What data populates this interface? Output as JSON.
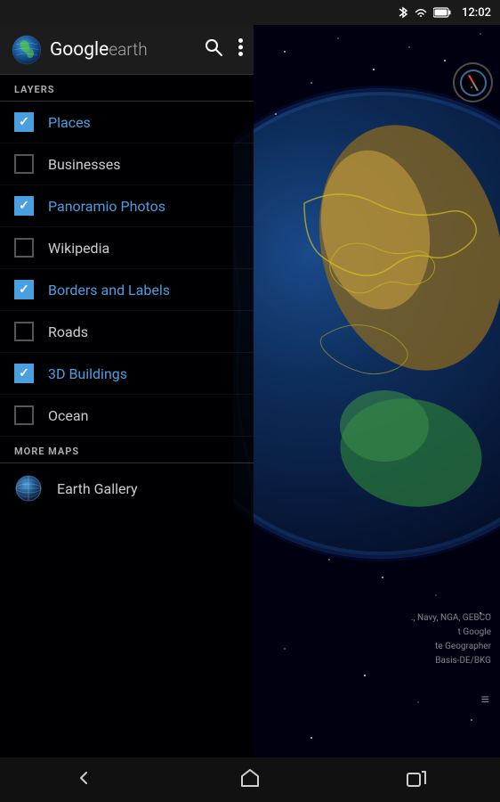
{
  "statusBar": {
    "time": "12:02",
    "icons": [
      "bluetooth",
      "wifi",
      "battery"
    ]
  },
  "header": {
    "title": "Google earth",
    "titleGoogle": "Google",
    "titleEarth": "earth",
    "searchIcon": "search",
    "moreIcon": "more-vertical"
  },
  "layers": {
    "sectionLabel": "LAYERS",
    "items": [
      {
        "id": "places",
        "label": "Places",
        "checked": true,
        "active": true
      },
      {
        "id": "businesses",
        "label": "Businesses",
        "checked": false,
        "active": false
      },
      {
        "id": "panoramio",
        "label": "Panoramio Photos",
        "checked": true,
        "active": true
      },
      {
        "id": "wikipedia",
        "label": "Wikipedia",
        "checked": false,
        "active": false
      },
      {
        "id": "borders",
        "label": "Borders and Labels",
        "checked": true,
        "active": true
      },
      {
        "id": "roads",
        "label": "Roads",
        "checked": false,
        "active": false
      },
      {
        "id": "buildings",
        "label": "3D Buildings",
        "checked": true,
        "active": true
      },
      {
        "id": "ocean",
        "label": "Ocean",
        "checked": false,
        "active": false
      }
    ]
  },
  "moreMaps": {
    "sectionLabel": "MORE MAPS",
    "items": [
      {
        "id": "earthgallery",
        "label": "Earth Gallery",
        "icon": "globe"
      }
    ]
  },
  "attribution": {
    "lines": [
      "., Navy, NGA, GEBCO",
      "t Google",
      "te Geographer",
      "Basis-DE/BKG"
    ]
  },
  "navBar": {
    "back": "←",
    "home": "⌂",
    "recents": "▭"
  },
  "colors": {
    "activeBlue": "#4a9fe0",
    "checkBlue": "#4a9fe0",
    "background": "#000000",
    "panelBg": "#000000",
    "headerBg": "#1c1c1c"
  }
}
